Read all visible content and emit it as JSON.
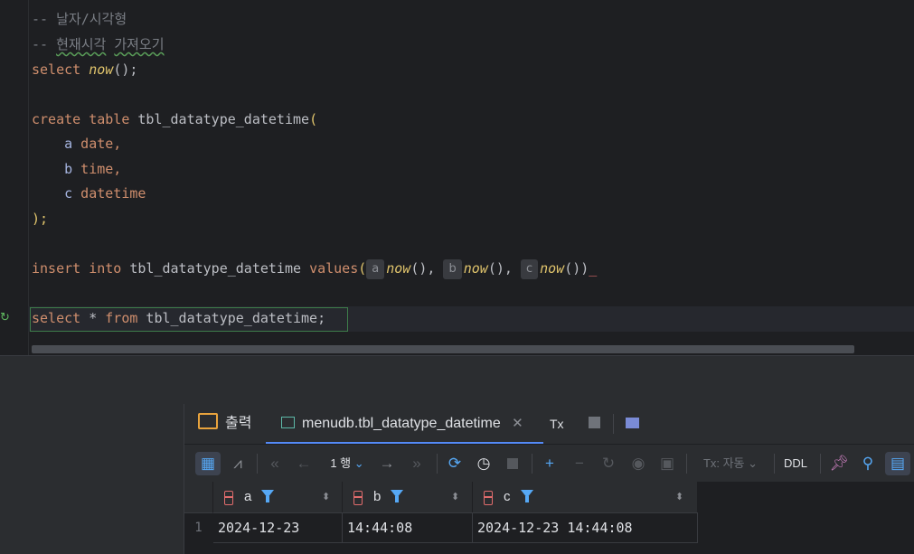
{
  "editor": {
    "comment1": "-- 날자/시각형",
    "comment2_prefix": "-- ",
    "comment2_word1": "현재시각",
    "comment2_space": " ",
    "comment2_word2": "가져오기",
    "l3_kw": "select",
    "l3_fn": "now",
    "l3_rest": "();",
    "l5_kw": "create table",
    "l5_name": " tbl_datatype_datetime",
    "l5_paren": "(",
    "l6_col": "a",
    "l6_type": " date,",
    "l7_col": "b",
    "l7_type": " time,",
    "l8_col": "c",
    "l8_type": " datetime",
    "l9": ");",
    "l11_kw": "insert into",
    "l11_name": " tbl_datatype_datetime ",
    "l11_values": "values",
    "l11_paren_open": "(",
    "hint_a": "a",
    "hint_b": "b",
    "hint_c": "c",
    "l11_fn": "now",
    "l11_call_sep": "(), ",
    "l11_call_end": "())",
    "l11_close": "_",
    "l13_kw1": "select",
    "l13_star": " * ",
    "l13_kw2": "from",
    "l13_name": " tbl_datatype_datetime",
    "l13_semi": ";"
  },
  "services": {
    "tab_output": "출력",
    "tab_result": "menudb.tbl_datatype_datetime",
    "tab_tx": "Tx"
  },
  "toolbar": {
    "page_label": "1 행",
    "tx_mode": "Tx: 자동",
    "ddl": "DDL"
  },
  "grid": {
    "columns": [
      "a",
      "b",
      "c"
    ],
    "rows": [
      {
        "num": "1",
        "a": "2024-12-23",
        "b": "14:44:08",
        "c": "2024-12-23 14:44:08"
      }
    ]
  },
  "colors": {
    "accent": "#548af7",
    "keyword": "#cf8e6d",
    "function": "#e0c46c",
    "column": "#c77dbb"
  }
}
